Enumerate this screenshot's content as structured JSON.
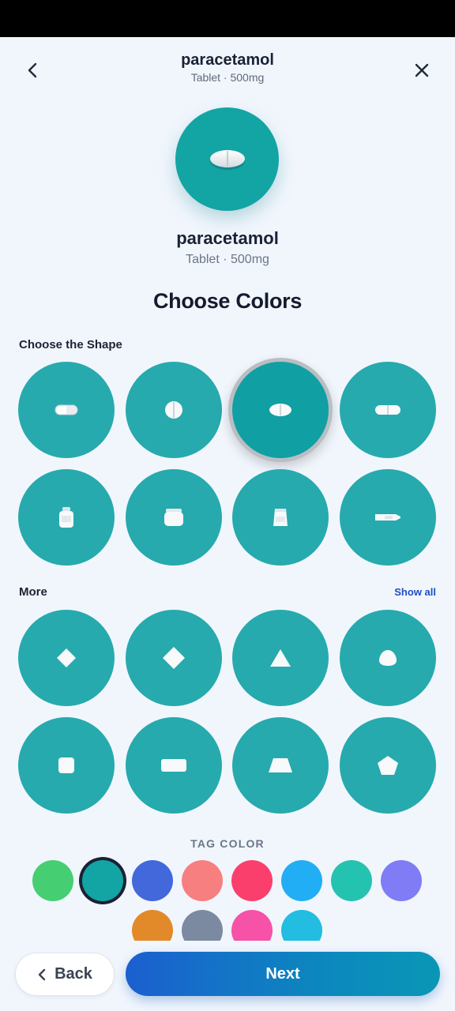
{
  "header": {
    "title": "paracetamol",
    "subtitle": "Tablet · 500mg",
    "back_icon": "chevron-left-icon",
    "close_icon": "close-icon"
  },
  "hero": {
    "name": "paracetamol",
    "subtitle": "Tablet · 500mg"
  },
  "heading": "Choose Colors",
  "shape_section": {
    "label": "Choose the Shape",
    "shapes": [
      {
        "name": "capsule"
      },
      {
        "name": "round-tablet"
      },
      {
        "name": "oval-tablet",
        "selected": true
      },
      {
        "name": "oblong-tablet"
      },
      {
        "name": "bottle"
      },
      {
        "name": "jar"
      },
      {
        "name": "pouch"
      },
      {
        "name": "tube"
      }
    ]
  },
  "more_section": {
    "label": "More",
    "show_all_label": "Show all",
    "shapes": [
      {
        "name": "diamond-small"
      },
      {
        "name": "diamond"
      },
      {
        "name": "triangle"
      },
      {
        "name": "egg"
      },
      {
        "name": "square"
      },
      {
        "name": "rectangle"
      },
      {
        "name": "trapezoid"
      },
      {
        "name": "pentagon"
      }
    ]
  },
  "tag_color": {
    "label": "TAG COLOR",
    "selected": "#13a4a4",
    "colors": [
      "#45cf72",
      "#13a4a4",
      "#4268dc",
      "#f87f7f",
      "#fb3f6c",
      "#22aef5",
      "#24c3b0",
      "#7f7cf6",
      "#e2892a",
      "#7b8aa0",
      "#f552a8",
      "#22bde0"
    ]
  },
  "footer": {
    "back_label": "Back",
    "next_label": "Next"
  },
  "colors": {
    "teal": "#26aaad",
    "accent": "#1f4fc6",
    "background": "#f1f6fd"
  }
}
